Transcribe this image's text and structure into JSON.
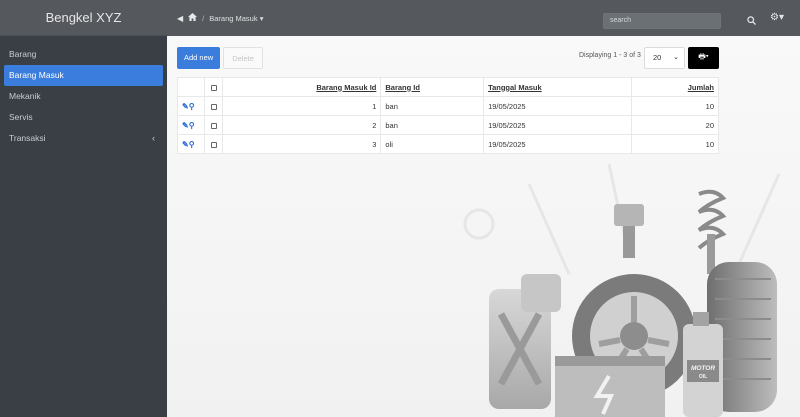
{
  "app": {
    "brand": "Bengkel XYZ"
  },
  "sidebar": {
    "items": [
      {
        "label": "Barang",
        "active": false
      },
      {
        "label": "Barang Masuk",
        "active": true
      },
      {
        "label": "Mekanik",
        "active": false
      },
      {
        "label": "Servis",
        "active": false
      },
      {
        "label": "Transaksi",
        "active": false,
        "has_submenu": true
      }
    ]
  },
  "topbar": {
    "breadcrumb": {
      "separator": "/",
      "current": "Barang Masuk"
    },
    "search_placeholder": "search"
  },
  "toolbar": {
    "add_label": "Add new",
    "delete_label": "Delete",
    "display_info": "Displaying 1 - 3 of 3",
    "page_size": "20"
  },
  "table": {
    "columns": [
      "Barang Masuk Id",
      "Barang Id",
      "Tanggal Masuk",
      "Jumlah"
    ],
    "rows": [
      {
        "id": "1",
        "barang_id": "ban",
        "tanggal": "19/05/2025",
        "jumlah": "10"
      },
      {
        "id": "2",
        "barang_id": "ban",
        "tanggal": "19/05/2025",
        "jumlah": "20"
      },
      {
        "id": "3",
        "barang_id": "oli",
        "tanggal": "19/05/2025",
        "jumlah": "10"
      }
    ]
  },
  "illustration": {
    "oil_label_1": "MOTOR",
    "oil_label_2": "OIL"
  },
  "colors": {
    "accent": "#3b7ddd",
    "sidebar": "#3a3f45",
    "topbar": "#55595e"
  },
  "icons": {
    "home": "home-icon",
    "search": "search-icon",
    "settings": "gear-icon",
    "print": "print-icon",
    "edit": "pencil-icon",
    "view": "magnifier-icon"
  }
}
